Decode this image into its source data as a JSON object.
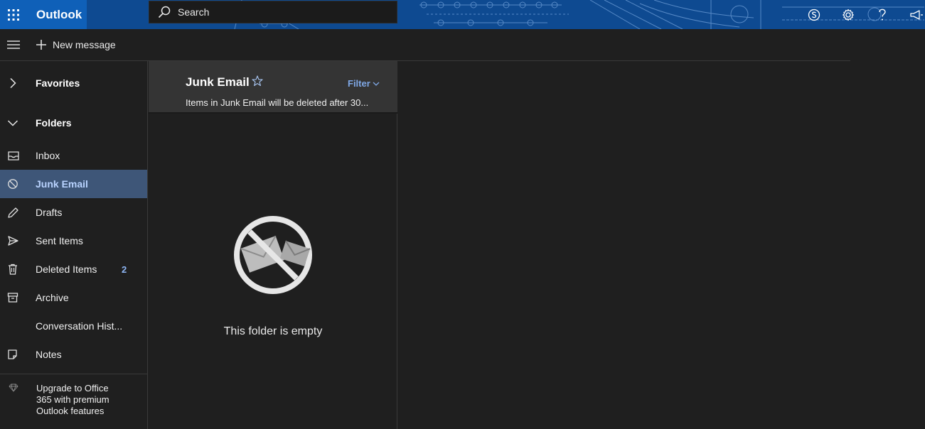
{
  "header": {
    "app_name": "Outlook",
    "search": {
      "label": "Search"
    },
    "icons": [
      "app-launcher-icon",
      "skype-icon",
      "gear-icon",
      "help-icon",
      "feedback-megaphone-icon"
    ],
    "colors": {
      "banner": "#0e4a91",
      "brand_tile": "#0f60b8"
    }
  },
  "commandbar": {
    "new_message_label": "New message"
  },
  "sidebar": {
    "favorites_label": "Favorites",
    "folders_label": "Folders",
    "items": [
      {
        "label": "Inbox",
        "icon": "inbox-icon",
        "count": ""
      },
      {
        "label": "Junk Email",
        "icon": "block-icon",
        "count": "",
        "selected": true
      },
      {
        "label": "Drafts",
        "icon": "pencil-icon",
        "count": ""
      },
      {
        "label": "Sent Items",
        "icon": "send-icon",
        "count": ""
      },
      {
        "label": "Deleted Items",
        "icon": "trash-icon",
        "count": "2"
      },
      {
        "label": "Archive",
        "icon": "archive-icon",
        "count": ""
      },
      {
        "label": "Conversation Hist...",
        "icon": "",
        "count": ""
      },
      {
        "label": "Notes",
        "icon": "note-icon",
        "count": ""
      }
    ],
    "upgrade": {
      "line1": "Upgrade to Office",
      "line2": "365 with premium",
      "line3": "Outlook features"
    },
    "colors": {
      "selected_bg": "#3e5678",
      "count": "#8fb7f5"
    }
  },
  "message_list": {
    "title": "Junk Email",
    "filter_label": "Filter",
    "notice": "Items in Junk Email will be deleted after 30...",
    "empty_text": "This folder is empty",
    "colors": {
      "header_bg": "#343434",
      "filter": "#7fa8e6"
    }
  }
}
